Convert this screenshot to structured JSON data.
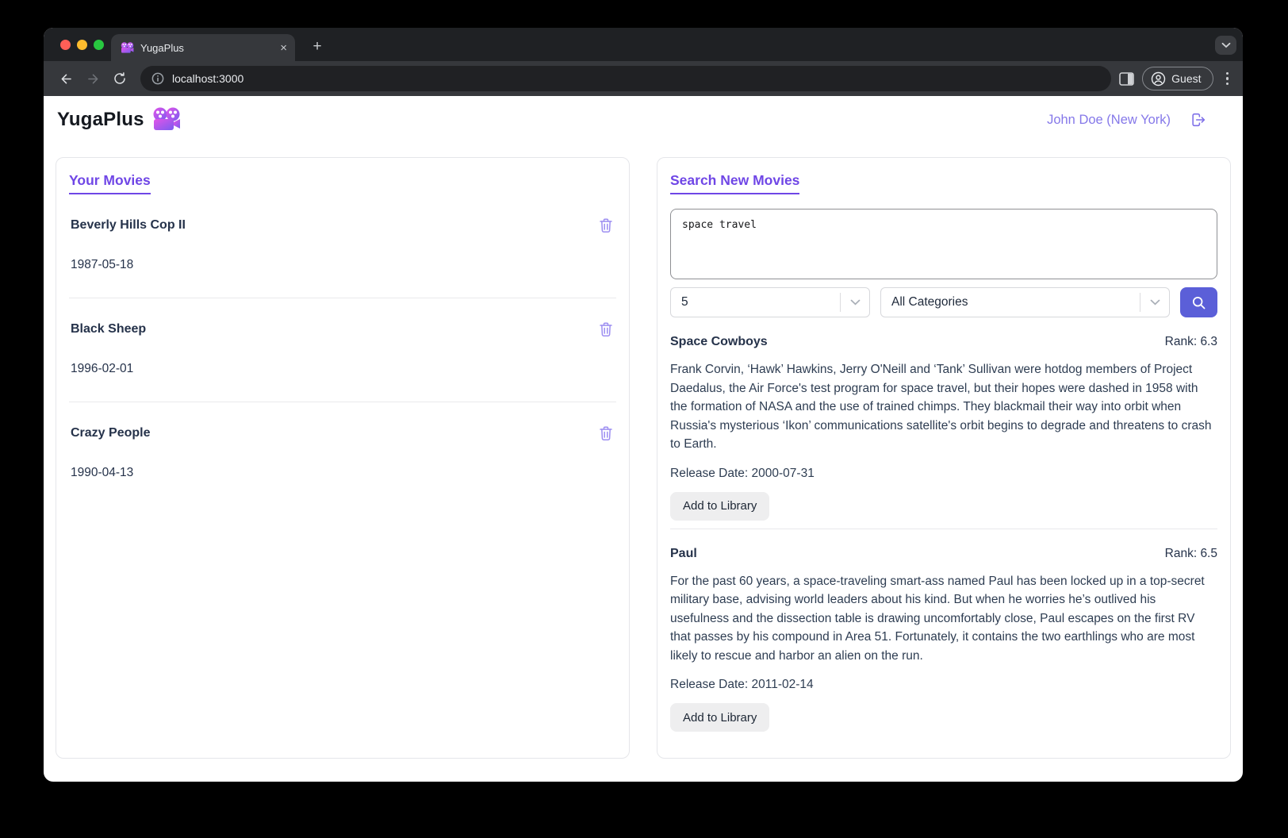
{
  "browser": {
    "tab_title": "YugaPlus",
    "close_glyph": "×",
    "newtab_glyph": "+",
    "url": "localhost:3000",
    "profile_label": "Guest"
  },
  "header": {
    "app_name": "YugaPlus",
    "user": "John Doe (New York)"
  },
  "library": {
    "title": "Your Movies",
    "movies": [
      {
        "title": "Beverly Hills Cop II",
        "date": "1987-05-18"
      },
      {
        "title": "Black Sheep",
        "date": "1996-02-01"
      },
      {
        "title": "Crazy People",
        "date": "1990-04-13"
      }
    ]
  },
  "search": {
    "title": "Search New Movies",
    "query": "space travel",
    "limit_value": "5",
    "category_value": "All Categories",
    "results": [
      {
        "title": "Space Cowboys",
        "rank_label": "Rank: 6.3",
        "description": "Frank Corvin, ‘Hawk’ Hawkins, Jerry O'Neill and ‘Tank’ Sullivan were hotdog members of Project Daedalus, the Air Force's test program for space travel, but their hopes were dashed in 1958 with the formation of NASA and the use of trained chimps. They blackmail their way into orbit when Russia's mysterious ‘Ikon’ communications satellite's orbit begins to degrade and threatens to crash to Earth.",
        "release_label": "Release Date: 2000-07-31",
        "add_label": "Add to Library"
      },
      {
        "title": "Paul",
        "rank_label": "Rank: 6.5",
        "description": "For the past 60 years, a space-traveling smart-ass named Paul has been locked up in a top-secret military base, advising world leaders about his kind. But when he worries he’s outlived his usefulness and the dissection table is drawing uncomfortably close, Paul escapes on the first RV that passes by his compound in Area 51. Fortunately, it contains the two earthlings who are most likely to rescue and harbor an alien on the run.",
        "release_label": "Release Date: 2011-02-14",
        "add_label": "Add to Library"
      }
    ]
  },
  "colors": {
    "accent_purple": "#6f46e6",
    "light_purple": "#9c8df1",
    "user_purple": "#8578e9",
    "search_button": "#5b5fd8"
  }
}
